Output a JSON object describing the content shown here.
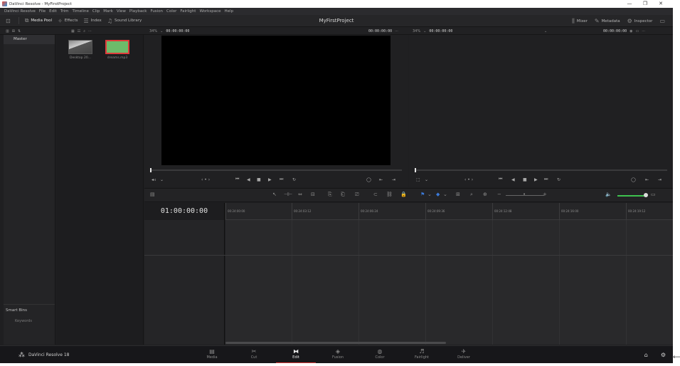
{
  "window": {
    "title": "DaVinci Resolve - MyFirstProject",
    "controls": [
      "—",
      "❐",
      "✕"
    ]
  },
  "menu": [
    "DaVinci Resolve",
    "File",
    "Edit",
    "Trim",
    "Timeline",
    "Clip",
    "Mark",
    "View",
    "Playback",
    "Fusion",
    "Color",
    "Fairlight",
    "Workspace",
    "Help"
  ],
  "toolbar": {
    "project_title": "MyFirstProject",
    "left": [
      {
        "icon": "⧉",
        "label": "Media Pool",
        "active": true
      },
      {
        "icon": "✧",
        "label": "Effects",
        "active": false
      },
      {
        "icon": "☰",
        "label": "Index",
        "active": false
      },
      {
        "icon": "♫",
        "label": "Sound Library",
        "active": false
      }
    ],
    "right": [
      {
        "icon": "⫼",
        "label": "Mixer"
      },
      {
        "icon": "✎",
        "label": "Metadata"
      },
      {
        "icon": "⚙",
        "label": "Inspector"
      }
    ]
  },
  "viewers": {
    "source": {
      "zoom": "34%",
      "timecode_left": "00:00:00:00",
      "timecode_right": "00:00:00:00"
    },
    "timeline": {
      "zoom": "34%",
      "timecode_left": "00:00:00:00",
      "timecode_right": "00:00:00:00"
    }
  },
  "bins": {
    "master": "Master",
    "smart_bins": "Smart Bins",
    "keywords": "Keywords"
  },
  "media_pool": {
    "clips": [
      {
        "name": "Desktop 20...",
        "selected": false
      },
      {
        "name": "dreams.mp3",
        "selected": true
      }
    ]
  },
  "timeline": {
    "timecode": "01:00:00:00",
    "ruler": [
      "00:24:00:00",
      "00:24:03:12",
      "00:24:06:24",
      "00:24:09:36",
      "00:24:12:48",
      "00:24:16:00",
      "00:24:19:12"
    ],
    "volume": 0.9
  },
  "pages": {
    "brand": "DaVinci Resolve 18",
    "items": [
      {
        "icon": "▤",
        "label": "Media"
      },
      {
        "icon": "✂",
        "label": "Cut"
      },
      {
        "icon": "⧓",
        "label": "Edit"
      },
      {
        "icon": "◈",
        "label": "Fusion"
      },
      {
        "icon": "◍",
        "label": "Color"
      },
      {
        "icon": "♬",
        "label": "Fairlight"
      },
      {
        "icon": "✈",
        "label": "Deliver"
      }
    ],
    "active": "Edit"
  },
  "colors": {
    "accent": "#e03b3b",
    "volume": "#3ec24f",
    "panel": "#1f1f21"
  }
}
